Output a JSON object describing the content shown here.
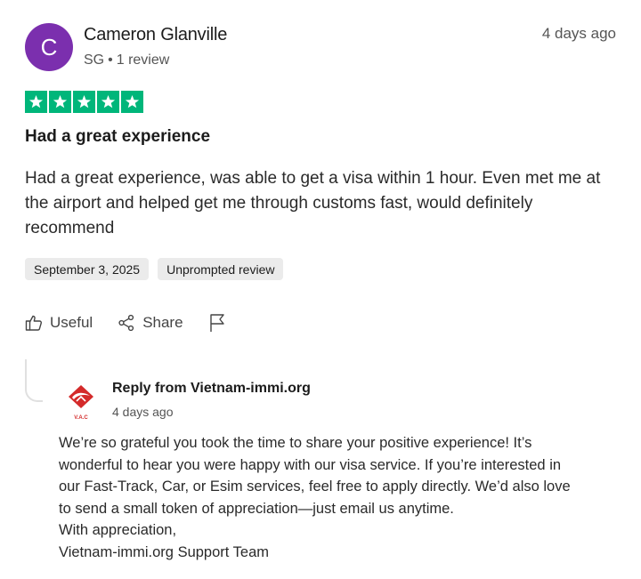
{
  "reviewer": {
    "initial": "C",
    "avatar_color": "#7b2fae",
    "name": "Cameron Glanville",
    "country": "SG",
    "review_count": "1 review"
  },
  "review": {
    "date_ago": "4 days ago",
    "rating": 5,
    "star_color": "#00b67a",
    "title": "Had a great experience",
    "body": "Had a great experience, was able to get a visa within 1 hour. Even met me at the airport and helped get me through customs fast, would definitely recommend",
    "date": "September 3, 2025",
    "tag": "Unprompted review"
  },
  "actions": {
    "useful_label": "Useful",
    "share_label": "Share",
    "useful_icon": "thumbs-up-icon",
    "share_icon": "share-icon",
    "flag_icon": "flag-icon"
  },
  "reply": {
    "from": "Reply from Vietnam-immi.org",
    "date_ago": "4 days ago",
    "logo_text": "V.A.C",
    "logo_color": "#d42a2a",
    "body_lines": [
      "We’re so grateful you took the time to share your positive experience! It’s",
      "wonderful to hear you were happy with our visa service. If you’re interested in",
      "our Fast-Track, Car, or Esim services, feel free to apply directly. We’d also love",
      "to send a small token of appreciation—just email us anytime.",
      "With appreciation,",
      "Vietnam-immi.org Support Team"
    ]
  }
}
